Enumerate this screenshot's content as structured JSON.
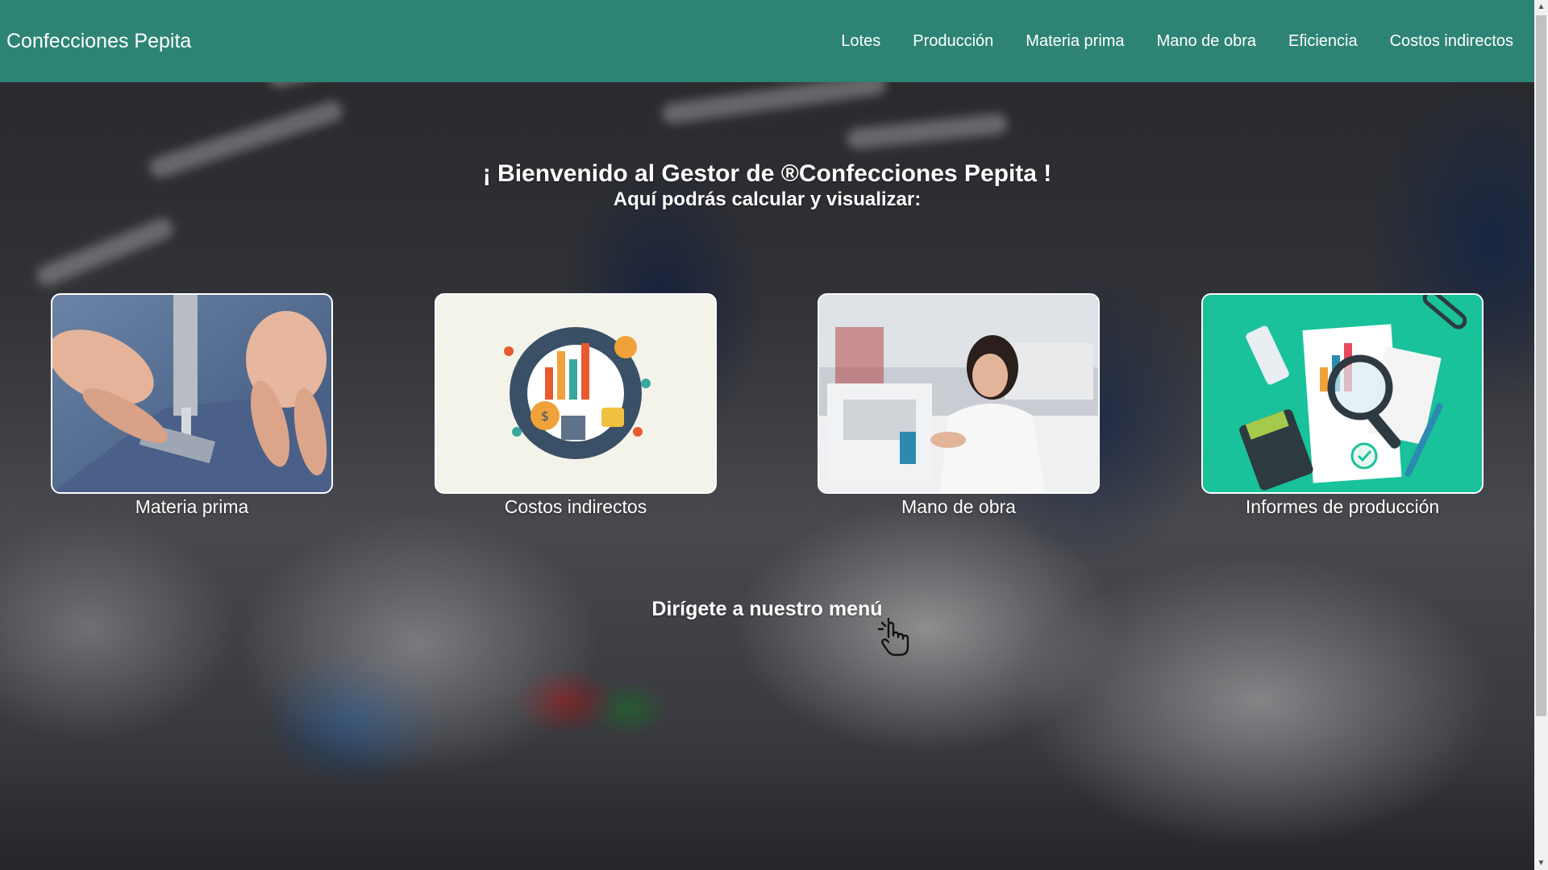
{
  "navbar": {
    "brand": "Confecciones Pepita",
    "links": [
      "Lotes",
      "Producción",
      "Materia prima",
      "Mano de obra",
      "Eficiencia",
      "Costos indirectos"
    ]
  },
  "hero": {
    "title": "¡ Bienvenido al Gestor de ®Confecciones Pepita !",
    "subtitle": "Aquí podrás calcular y visualizar:"
  },
  "cards": [
    {
      "label": "Materia prima",
      "image": "sewing-machine-hands-photo"
    },
    {
      "label": "Costos indirectos",
      "image": "finance-infographic-illustration"
    },
    {
      "label": "Mano de obra",
      "image": "seamstress-at-machine-photo"
    },
    {
      "label": "Informes de producción",
      "image": "report-magnifier-illustration"
    }
  ],
  "cta": {
    "text": "Dirígete a nuestro menú",
    "icon": "hand-pointer-icon"
  },
  "colors": {
    "navbar": "#2e8474",
    "text": "#ffffff",
    "report_card_bg": "#19c29a"
  }
}
